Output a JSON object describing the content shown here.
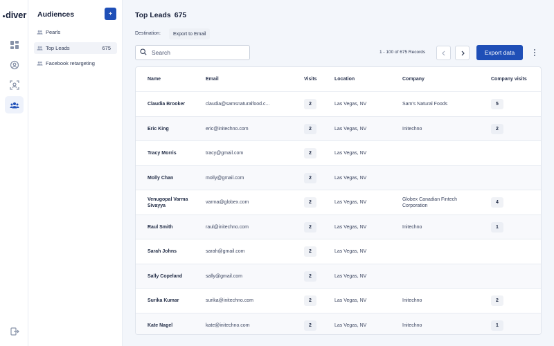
{
  "brand": {
    "logo_text": "diver"
  },
  "rail": {
    "items": [
      {
        "icon": "dashboard-icon"
      },
      {
        "icon": "user-search-icon"
      },
      {
        "icon": "face-scan-icon"
      },
      {
        "icon": "users-group-icon",
        "active": true
      }
    ],
    "bottom_icon": "logout-icon"
  },
  "audiences": {
    "title": "Audiences",
    "add_label": "+",
    "items": [
      {
        "label": "Pearls",
        "count": ""
      },
      {
        "label": "Top Leads",
        "count": "675",
        "active": true
      },
      {
        "label": "Facebook retargeting",
        "count": ""
      }
    ]
  },
  "main": {
    "title": "Top Leads",
    "title_count": "675",
    "destination_label": "Destination:",
    "destination_value": "Export to Email",
    "search_placeholder": "Search",
    "records_text": "1 - 100  of  675  Records",
    "export_label": "Export data"
  },
  "table": {
    "columns": [
      "Name",
      "Email",
      "Visits",
      "Location",
      "Company",
      "Company visits"
    ],
    "rows": [
      {
        "name": "Claudia Brooker",
        "email": "claudia@samsnaturalfood.c...",
        "visits": "2",
        "location": "Las Vegas, NV",
        "company": "Sam's Natural Foods",
        "company_visits": "5"
      },
      {
        "name": "Eric King",
        "email": "eric@initechno.com",
        "visits": "2",
        "location": "Las Vegas, NV",
        "company": "Initechno",
        "company_visits": "2"
      },
      {
        "name": "Tracy Morris",
        "email": "tracy@gmail.com",
        "visits": "2",
        "location": "Las Vegas, NV",
        "company": "",
        "company_visits": ""
      },
      {
        "name": "Molly Chan",
        "email": "molly@gmail.com",
        "visits": "2",
        "location": "Las Vegas, NV",
        "company": "",
        "company_visits": ""
      },
      {
        "name": "Venugopal Varma Sivayya",
        "email": "varma@globex.com",
        "visits": "2",
        "location": "Las Vegas, NV",
        "company": "Globex Canadian Fintech Corporation",
        "company_visits": "4"
      },
      {
        "name": "Raul Smith",
        "email": "raul@initechno.com",
        "visits": "2",
        "location": "Las Vegas, NV",
        "company": "Initechno",
        "company_visits": "1"
      },
      {
        "name": "Sarah Johns",
        "email": "sarah@gmail.com",
        "visits": "2",
        "location": "Las Vegas, NV",
        "company": "",
        "company_visits": ""
      },
      {
        "name": "Sally Copeland",
        "email": "sally@gmail.com",
        "visits": "2",
        "location": "Las Vegas, NV",
        "company": "",
        "company_visits": ""
      },
      {
        "name": "Surika Kumar",
        "email": "surika@initechno.com",
        "visits": "2",
        "location": "Las Vegas, NV",
        "company": "Initechno",
        "company_visits": "2"
      },
      {
        "name": "Kate Nagel",
        "email": "kate@initechno.com",
        "visits": "2",
        "location": "Las Vegas, NV",
        "company": "Initechno",
        "company_visits": "1"
      }
    ]
  },
  "colors": {
    "accent": "#1f4fb7",
    "text": "#17203a",
    "background": "#f3f6fb"
  }
}
